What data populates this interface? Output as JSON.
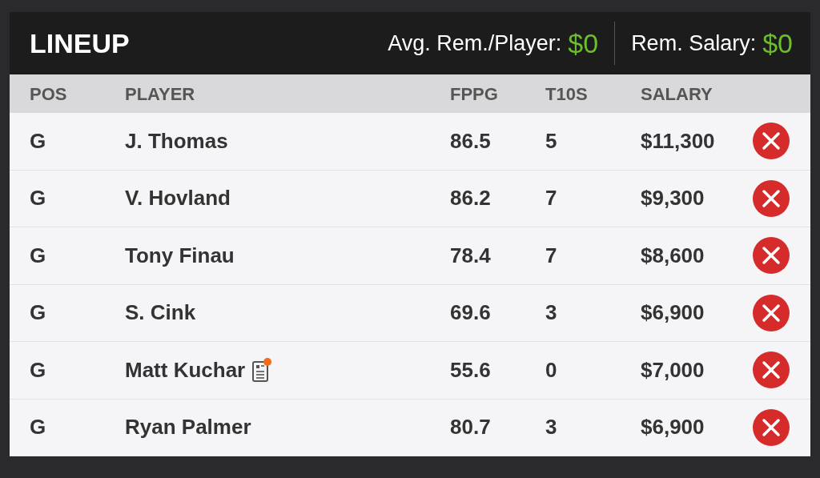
{
  "header": {
    "title": "LINEUP",
    "stats": [
      {
        "label": "Avg. Rem./Player:",
        "value": "$0"
      },
      {
        "label": "Rem. Salary:",
        "value": "$0"
      }
    ]
  },
  "columns": [
    "POS",
    "PLAYER",
    "FPPG",
    "T10S",
    "SALARY"
  ],
  "rows": [
    {
      "pos": "G",
      "player": "J. Thomas",
      "news": false,
      "fppg": "86.5",
      "t10s": "5",
      "salary": "$11,300"
    },
    {
      "pos": "G",
      "player": "V. Hovland",
      "news": false,
      "fppg": "86.2",
      "t10s": "7",
      "salary": "$9,300"
    },
    {
      "pos": "G",
      "player": "Tony Finau",
      "news": false,
      "fppg": "78.4",
      "t10s": "7",
      "salary": "$8,600"
    },
    {
      "pos": "G",
      "player": "S. Cink",
      "news": false,
      "fppg": "69.6",
      "t10s": "3",
      "salary": "$6,900"
    },
    {
      "pos": "G",
      "player": "Matt Kuchar",
      "news": true,
      "fppg": "55.6",
      "t10s": "0",
      "salary": "$7,000"
    },
    {
      "pos": "G",
      "player": "Ryan Palmer",
      "news": false,
      "fppg": "80.7",
      "t10s": "3",
      "salary": "$6,900"
    }
  ]
}
